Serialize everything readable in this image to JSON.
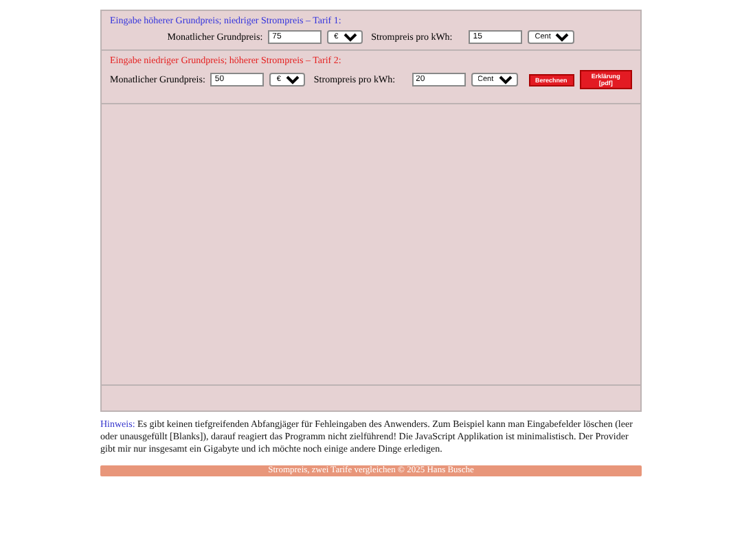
{
  "tariffs": [
    {
      "heading": "Eingabe höherer Grundpreis; niedriger Strompreis – Tarif 1:",
      "kind": "high-base",
      "base_label": "Monatlicher Grundpreis:",
      "base_value": "75",
      "base_unit": "€",
      "price_label": "Strompreis pro kWh:",
      "price_value": "15",
      "price_unit": "Cent"
    },
    {
      "heading": "Eingabe niedriger Grundpreis; höherer Strompreis – Tarif 2:",
      "kind": "low-base",
      "base_label": "Monatlicher Grundpreis:",
      "base_value": "50",
      "base_unit": "€",
      "price_label": "Strompreis pro kWh:",
      "price_value": "20",
      "price_unit": "Cent"
    }
  ],
  "buttons": [
    "Berechnen",
    "Erklärung [pdf]"
  ],
  "note": {
    "label": "Hinweis:",
    "text": "Es gibt keinen tiefgreifenden Abfangjäger für Fehleingaben des Anwenders. Zum Beispiel kann man Eingabefelder löschen (leer oder unausgefüllt [Blanks]), darauf reagiert das Programm nicht zielführend! Die JavaScript Applikation ist minimalistisch. Der Provider gibt mir nur insgesamt ein Gigabyte und ich möchte noch einige andere Dinge erledigen."
  },
  "footer": "Strompreis, zwei Tarife vergleichen © 2025 Hans Busche"
}
